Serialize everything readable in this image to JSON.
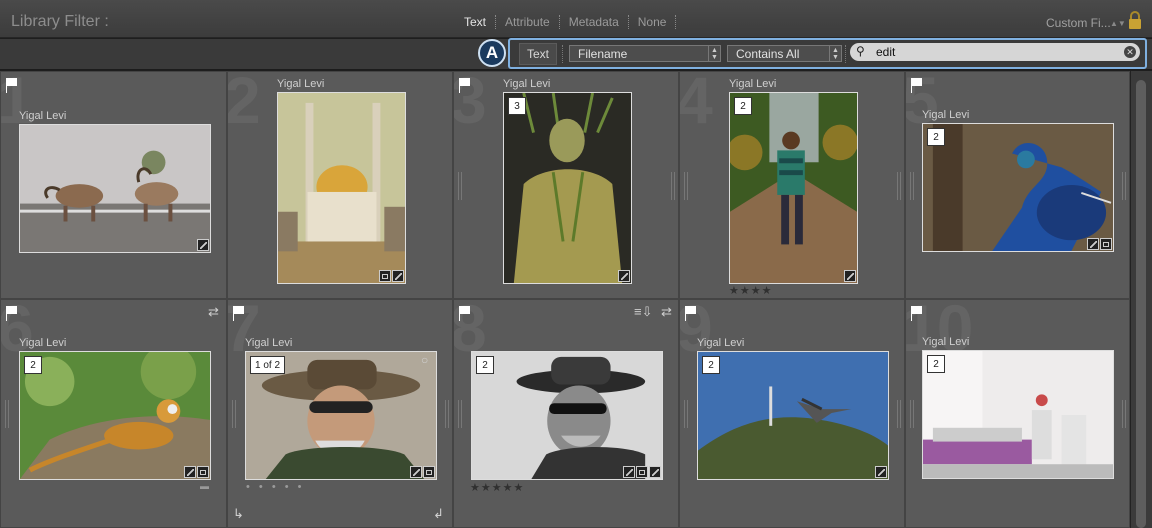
{
  "header": {
    "title": "Library Filter :",
    "tabs": [
      "Text",
      "Attribute",
      "Metadata",
      "None"
    ],
    "active_tab": "Text",
    "custom_filter": "Custom Fi...",
    "lock_icon": "lock-icon"
  },
  "filter": {
    "callout": "A",
    "text_label": "Text",
    "field": "Filename",
    "rule": "Contains All",
    "search_value": "edit",
    "search_icon": "search-icon",
    "clear_icon": "clear-icon"
  },
  "accent_color": "#7fb0e0",
  "photos": [
    {
      "num": "1",
      "author": "Yigal Levi",
      "stack": "",
      "stars": "",
      "subject": "ibex"
    },
    {
      "num": "2",
      "author": "Yigal Levi",
      "stack": "",
      "stars": "",
      "subject": "mosque"
    },
    {
      "num": "3",
      "author": "Yigal Levi",
      "stack": "3",
      "stars": "",
      "subject": "green statue"
    },
    {
      "num": "4",
      "author": "Yigal Levi",
      "stack": "2",
      "stars": "★★★★",
      "subject": "boy in orchard"
    },
    {
      "num": "5",
      "author": "Yigal Levi",
      "stack": "2",
      "stars": "",
      "subject": "peacock"
    },
    {
      "num": "6",
      "author": "Yigal Levi",
      "stack": "2",
      "stars": "",
      "subject": "monkey"
    },
    {
      "num": "7",
      "author": "Yigal Levi",
      "stack": "1 of 2",
      "stars": "• • • • •",
      "subject": "man with hat"
    },
    {
      "num": "8",
      "author": "Yigal Levi",
      "stack": "2",
      "stars": "★★★★★",
      "subject": "man with hat bw"
    },
    {
      "num": "9",
      "author": "Yigal Levi",
      "stack": "2",
      "stars": "",
      "subject": "stork over hill"
    },
    {
      "num": "10",
      "author": "Yigal Levi",
      "stack": "2",
      "stars": "",
      "subject": "clinic room"
    }
  ]
}
